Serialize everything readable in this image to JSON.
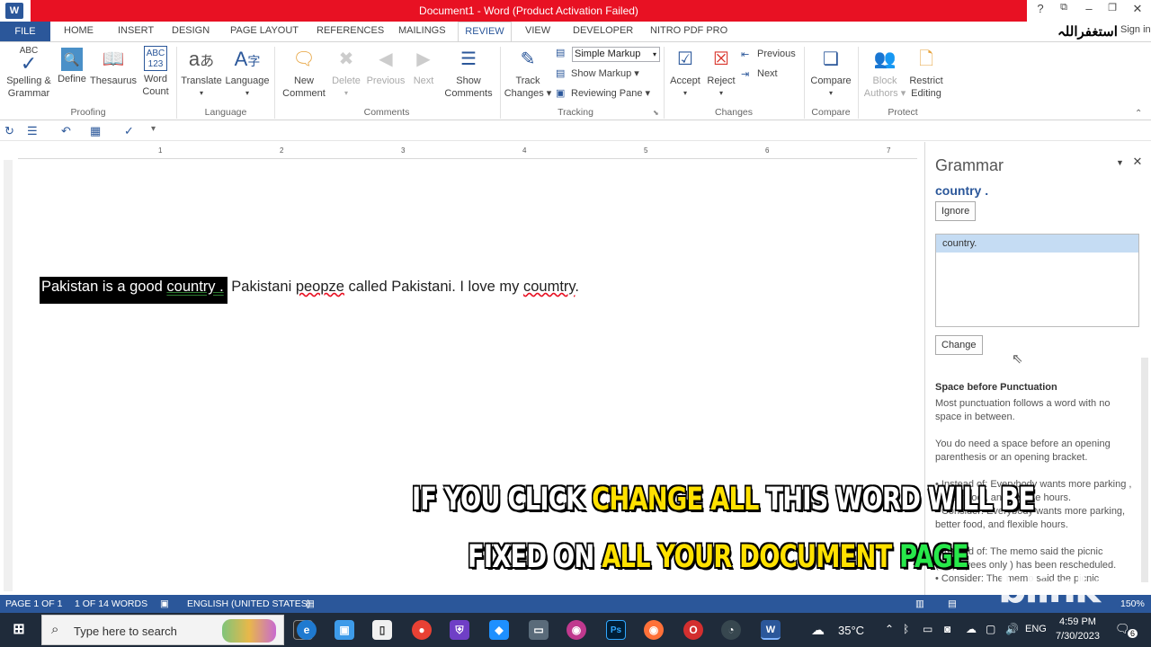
{
  "titlebar": {
    "title": "Document1 - Word (Product Activation Failed)",
    "app_icon": "W",
    "help": "?",
    "restore": "⧉",
    "minimize": "–",
    "maximize": "❐",
    "close": "✕",
    "accent": "#e81123"
  },
  "overlay": {
    "arabic": "استغفراللہ",
    "signin": "Sign in"
  },
  "tabs": {
    "file": "FILE",
    "home": "HOME",
    "insert": "INSERT",
    "design": "DESIGN",
    "page_layout": "PAGE LAYOUT",
    "references": "REFERENCES",
    "mailings": "MAILINGS",
    "review": "REVIEW",
    "view": "VIEW",
    "developer": "DEVELOPER",
    "nitro": "NITRO PDF PRO"
  },
  "ribbon": {
    "spelling": "Spelling &\nGrammar",
    "spelling_1": "Spelling &",
    "spelling_2": "Grammar",
    "define": "Define",
    "thesaurus": "Thesaurus",
    "wordcount_1": "Word",
    "wordcount_2": "Count",
    "proofing": "Proofing",
    "translate": "Translate",
    "language_btn": "Language",
    "language_grp": "Language",
    "new_comment_1": "New",
    "new_comment_2": "Comment",
    "delete": "Delete",
    "previous": "Previous",
    "next": "Next",
    "show_comments_1": "Show",
    "show_comments_2": "Comments",
    "comments_grp": "Comments",
    "track_1": "Track",
    "track_2": "Changes ▾",
    "simple_markup": "Simple Markup",
    "show_markup": "Show Markup ▾",
    "reviewing_pane": "Reviewing Pane ▾",
    "tracking_grp": "Tracking",
    "accept": "Accept",
    "reject": "Reject",
    "ch_previous": "Previous",
    "ch_next": "Next",
    "changes_grp": "Changes",
    "compare": "Compare",
    "compare_grp": "Compare",
    "block_1": "Block",
    "block_2": "Authors ▾",
    "restrict_1": "Restrict",
    "restrict_2": "Editing",
    "protect_grp": "Protect",
    "abc": "ABC",
    "abc123": "ABC\n123"
  },
  "document": {
    "selected_text": "Pakistan is a good ",
    "selected_flag": "country .",
    "rest_1": " Pakistani ",
    "misspell_1": "peopze",
    "rest_2": " called Pakistani. I love my ",
    "misspell_2": "coumtry",
    "rest_3": ".",
    "ruler": [
      "1",
      "2",
      "3",
      "4",
      "5",
      "6",
      "7"
    ]
  },
  "grammar_pane": {
    "title": "Grammar",
    "flagged": "country .",
    "ignore": "Ignore",
    "suggestion": "country.",
    "change": "Change",
    "explain_title": "Space before Punctuation",
    "p1": "Most punctuation follows a word with no space in between.",
    "p2": "You do need a space before an opening parenthesis or an opening bracket.",
    "p3": "• Instead of: Everybody wants more parking , better food , and flexible hours.",
    "p4": "• Consider: Everybody wants more parking, better food, and flexible hours.",
    "p5": "• Instead of: The memo said the picnic (employees only ) has been rescheduled.",
    "p6": "• Consider: The memo said the picnic"
  },
  "captions": {
    "l1_a": "IF YOU CLICK ",
    "l1_b": "CHANGE ALL",
    "l1_c": " THIS WORD WILL BE",
    "l2_a": "FIXED ON ",
    "l2_b": "ALL YOUR DOCUMENT",
    "l2_c": " PAGE"
  },
  "statusbar": {
    "page": "PAGE 1 OF 1",
    "words": "1 OF 14 WORDS",
    "language": "ENGLISH (UNITED STATES)",
    "zoom": "150%",
    "watermark": "blink"
  },
  "taskbar": {
    "search_placeholder": "Type here to search",
    "weather": "35°C",
    "lang": "ENG",
    "time": "4:59 PM",
    "date": "7/30/2023",
    "notif": "6"
  }
}
